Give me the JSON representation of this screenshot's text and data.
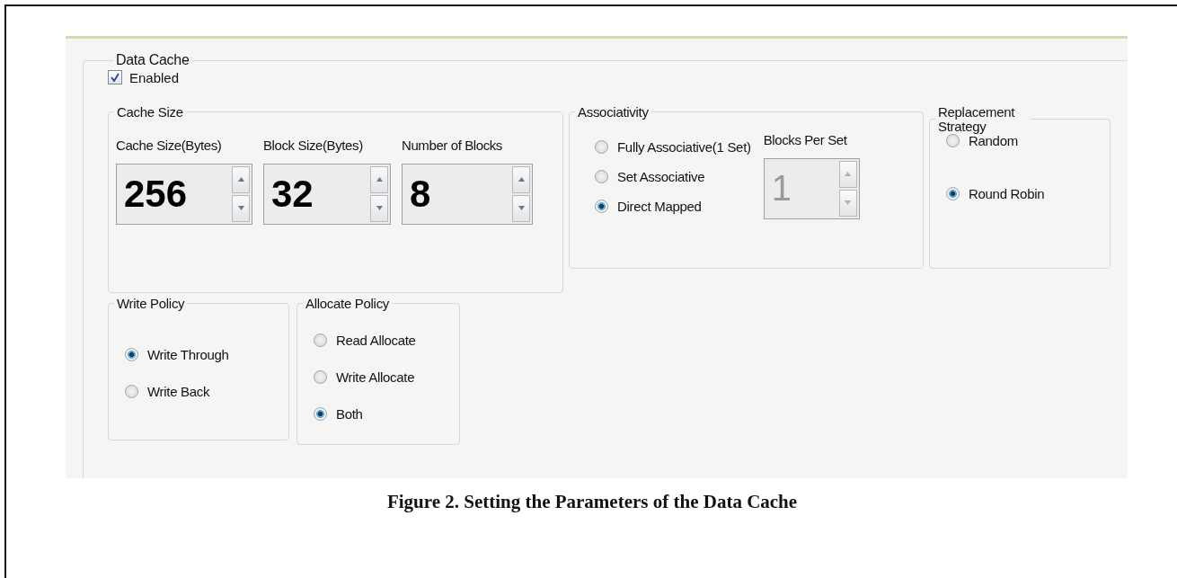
{
  "panel": {
    "title": "Data Cache",
    "enabled": {
      "label": "Enabled",
      "checked": true
    },
    "cache_size": {
      "title": "Cache Size",
      "fields": [
        {
          "label": "Cache Size(Bytes)",
          "value": "256",
          "disabled": false
        },
        {
          "label": "Block Size(Bytes)",
          "value": "32",
          "disabled": false
        },
        {
          "label": "Number of Blocks",
          "value": "8",
          "disabled": false
        }
      ]
    },
    "associativity": {
      "title": "Associativity",
      "options": [
        {
          "label": "Fully Associative(1 Set)",
          "selected": false
        },
        {
          "label": "Set Associative",
          "selected": false
        },
        {
          "label": "Direct Mapped",
          "selected": true
        }
      ],
      "blocks_per_set": {
        "label": "Blocks Per Set",
        "value": "1",
        "disabled": true
      }
    },
    "replacement": {
      "title": "Replacement Strategy",
      "options": [
        {
          "label": "Random",
          "selected": false
        },
        {
          "label": "Round Robin",
          "selected": true
        }
      ]
    },
    "write_policy": {
      "title": "Write Policy",
      "options": [
        {
          "label": "Write Through",
          "selected": true
        },
        {
          "label": "Write Back",
          "selected": false
        }
      ]
    },
    "allocate_policy": {
      "title": "Allocate Policy",
      "options": [
        {
          "label": "Read Allocate",
          "selected": false
        },
        {
          "label": "Write Allocate",
          "selected": false
        },
        {
          "label": "Both",
          "selected": true
        }
      ]
    }
  },
  "caption": "Figure 2. Setting the Parameters of the Data Cache"
}
